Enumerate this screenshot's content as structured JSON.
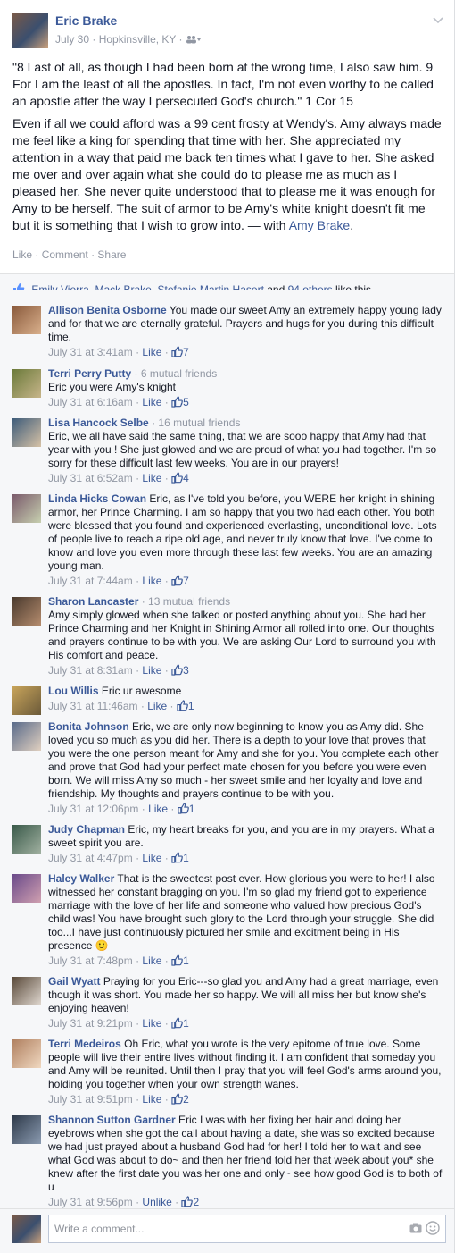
{
  "post": {
    "author": "Eric Brake",
    "date": "July 30",
    "sep": "·",
    "location": "Hopkinsville, KY",
    "audience_icon": "friends-icon",
    "paragraph1_text": "\"8 Last of all, as though I had been born at the wrong time, I also saw him. 9 For I am the least of all the apostles. In fact, I'm not even worthy to be called an apostle after the way I persecuted God's church.\" 1 Cor 15",
    "paragraph2_text": "Even if all we could afford was a 99 cent frosty at Wendy's. Amy always made me feel like a king for spending that time with her. She appreciated my attention in a way that paid me back ten times what I gave to her. She asked me over and over again what she could do to please me as much as I pleased her. She never quite understood that to please me it was enough for Amy to be herself. The suit of armor to be Amy's white knight doesn't fit me but it is something that I wish to grow into.",
    "with_prefix": "— with",
    "with_name": "Amy Brake",
    "with_suffix": "."
  },
  "actions": {
    "like": "Like",
    "comment": "Comment",
    "share": "Share",
    "dot": "·"
  },
  "likes": {
    "name1": "Emily Vierra",
    "name2": "Mack Brake",
    "name3": "Stefanie Martin Hasert",
    "and": "and",
    "others": "94 others",
    "suffix": "like this."
  },
  "comments": [
    {
      "name": "Allison Benita Osborne",
      "mutual": "",
      "text": "You made our sweet Amy an extremely happy young lady and for that we are eternally grateful. Prayers and hugs for you during this difficult time.",
      "time": "July 31 at 3:41am",
      "like": "Like",
      "count": "7"
    },
    {
      "name": "Terri Perry Putty",
      "mutual": "· 6 mutual friends",
      "text": "Eric you were Amy's knight",
      "time": "July 31 at 6:16am",
      "like": "Like",
      "count": "5"
    },
    {
      "name": "Lisa Hancock Selbe",
      "mutual": "· 16 mutual friends",
      "text": "Eric, we all have said the same thing, that we are sooo happy that Amy had that year with you ! She just glowed and we are proud of what you had together. I'm so sorry for these difficult last few weeks. You are in our prayers!",
      "time": "July 31 at 6:52am",
      "like": "Like",
      "count": "4"
    },
    {
      "name": "Linda Hicks Cowan",
      "mutual": "",
      "text": "Eric, as I've told you before, you WERE her knight in shining armor, her Prince Charming. I am so happy that you two had each other. You both were blessed that you found and experienced everlasting, unconditional love. Lots of people live to reach a ripe old age, and never truly know that love. I've come to know and love you even more through these last few weeks. You are an amazing young man.",
      "time": "July 31 at 7:44am",
      "like": "Like",
      "count": "7"
    },
    {
      "name": "Sharon Lancaster",
      "mutual": "· 13 mutual friends",
      "text": "Amy simply glowed when she talked or posted anything about you. She had her Prince Charming and her Knight in Shining Armor all rolled into one. Our thoughts and prayers continue to be with you. We are asking Our Lord to surround you with His comfort and peace.",
      "time": "July 31 at 8:31am",
      "like": "Like",
      "count": "3"
    },
    {
      "name": "Lou Willis",
      "mutual": "",
      "text": "Eric ur awesome",
      "time": "July 31 at 11:46am",
      "like": "Like",
      "count": "1"
    },
    {
      "name": "Bonita Johnson",
      "mutual": "",
      "text": "Eric, we are only now beginning to know you as Amy did. She loved you so much as you did her. There is a depth to your love that proves that you were the one person meant for Amy and she for you. You complete each other and prove that God had your perfect mate chosen for you before you were even born. We will miss Amy so much - her sweet smile and her loyalty and love and friendship. My thoughts and prayers continue to be with you.",
      "time": "July 31 at 12:06pm",
      "like": "Like",
      "count": "1"
    },
    {
      "name": "Judy Chapman",
      "mutual": "",
      "text": "Eric, my heart breaks for you, and you are in my prayers. What a sweet spirit you are.",
      "time": "July 31 at 4:47pm",
      "like": "Like",
      "count": "1"
    },
    {
      "name": "Haley Walker",
      "mutual": "",
      "text": "That is the sweetest post ever. How glorious you were to her! I also witnessed her constant bragging on you. I'm so glad my friend got to experience marriage with the love of her life and someone who valued how precious God's child was! You have brought such glory to the Lord through your struggle. She did too...I have just continuously pictured her smile and excitment being in His presence 🙂",
      "time": "July 31 at 7:48pm",
      "like": "Like",
      "count": "1"
    },
    {
      "name": "Gail Wyatt",
      "mutual": "",
      "text": "Praying for you Eric---so glad you and Amy had a great marriage, even though it was short. You made her so happy. We will all miss her but know she's enjoying heaven!",
      "time": "July 31 at 9:21pm",
      "like": "Like",
      "count": "1"
    },
    {
      "name": "Terri Medeiros",
      "mutual": "",
      "text": "Oh Eric, what you wrote is the very epitome of true love. Some people will live their entire lives without finding it. I am confident that someday you and Amy will be reunited. Until then I pray that you will feel God's arms around you, holding you together when your own strength wanes.",
      "time": "July 31 at 9:51pm",
      "like": "Like",
      "count": "2"
    },
    {
      "name": "Shannon Sutton Gardner",
      "mutual": "",
      "text": "Eric I was with her fixing her hair and doing her eyebrows when she got the call about having a date, she was so excited because we had just prayed about a husband God had for her! I told her to wait and see what God was about to do~ and then her friend told her that week about you* she knew after the first date you was her one and only~ see how good God is to both of u",
      "time": "July 31 at 9:56pm",
      "like": "Unlike",
      "count": "2"
    }
  ],
  "composer": {
    "placeholder": "Write a comment...",
    "camera_icon": "camera-icon",
    "emoji_icon": "emoji-icon"
  },
  "colors": {
    "link": "#3b5998",
    "meta": "#9197a3",
    "background": "#f6f7f9"
  }
}
